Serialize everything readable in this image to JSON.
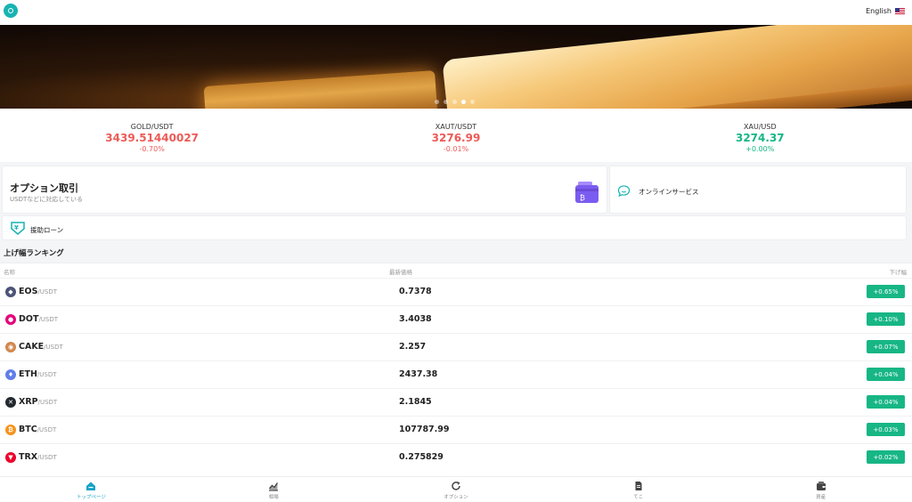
{
  "header": {
    "language_label": "English",
    "language_flag_icon": "us-flag-icon",
    "logo_icon": "app-logo-icon"
  },
  "banner": {
    "slide_count": 5,
    "active_slide": 4
  },
  "tickers": [
    {
      "symbol": "GOLD/USDT",
      "price": "3439.51440027",
      "change": "-0.70%",
      "direction": "down"
    },
    {
      "symbol": "XAUT/USDT",
      "price": "3276.99",
      "change": "-0.01%",
      "direction": "down"
    },
    {
      "symbol": "XAU/USD",
      "price": "3274.37",
      "change": "+0.00%",
      "direction": "up"
    }
  ],
  "cards": {
    "options": {
      "title": "オプション取引",
      "subtitle": "USDTなどに対応している",
      "icon": "wallet-icon"
    },
    "online": {
      "label": "オンラインサービス",
      "icon": "chat-icon"
    },
    "loan": {
      "label": "援助ローン",
      "icon": "loan-icon"
    }
  },
  "ranking": {
    "title": "上げ幅ランキング",
    "headers": {
      "name": "名称",
      "price": "最新価格",
      "change": "下げ幅"
    },
    "rows": [
      {
        "coin": "EOS",
        "quote": "/USDT",
        "price": "0.7378",
        "change": "+0.65%",
        "icon_color": "#4b5478",
        "glyph": "◆"
      },
      {
        "coin": "DOT",
        "quote": "/USDT",
        "price": "3.4038",
        "change": "+0.10%",
        "icon_color": "#e6007a",
        "glyph": "●"
      },
      {
        "coin": "CAKE",
        "quote": "/USDT",
        "price": "2.257",
        "change": "+0.07%",
        "icon_color": "#d1884f",
        "glyph": "◉"
      },
      {
        "coin": "ETH",
        "quote": "/USDT",
        "price": "2437.38",
        "change": "+0.04%",
        "icon_color": "#627eea",
        "glyph": "♦"
      },
      {
        "coin": "XRP",
        "quote": "/USDT",
        "price": "2.1845",
        "change": "+0.04%",
        "icon_color": "#23292f",
        "glyph": "✕"
      },
      {
        "coin": "BTC",
        "quote": "/USDT",
        "price": "107787.99",
        "change": "+0.03%",
        "icon_color": "#f7931a",
        "glyph": "₿"
      },
      {
        "coin": "TRX",
        "quote": "/USDT",
        "price": "0.275829",
        "change": "+0.02%",
        "icon_color": "#eb0029",
        "glyph": "▼"
      }
    ]
  },
  "nav": [
    {
      "label": "トップページ",
      "icon": "home-icon",
      "active": true
    },
    {
      "label": "相場",
      "icon": "chart-icon",
      "active": false
    },
    {
      "label": "オプション",
      "icon": "refresh-icon",
      "active": false
    },
    {
      "label": "てこ",
      "icon": "document-icon",
      "active": false
    },
    {
      "label": "資産",
      "icon": "wallet-icon",
      "active": false
    }
  ],
  "colors": {
    "accent": "#17a3c8",
    "up": "#17b685",
    "down": "#ec5b57",
    "wallet_purple": "#7b5cf0"
  }
}
